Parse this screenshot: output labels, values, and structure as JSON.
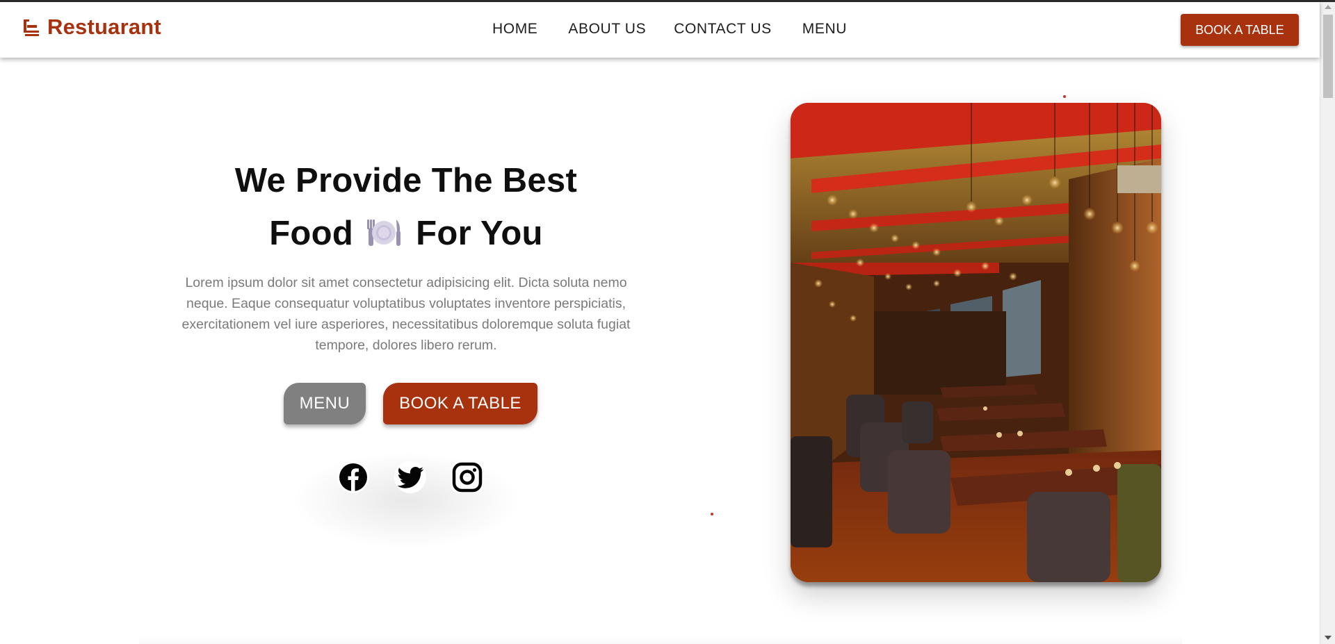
{
  "brand": {
    "name": "Restuarant",
    "icon": "chef-hat-icon",
    "color": "#a8320d"
  },
  "nav": {
    "items": [
      {
        "label": "HOME"
      },
      {
        "label": "ABOUT US"
      },
      {
        "label": "CONTACT US"
      },
      {
        "label": "MENU"
      }
    ],
    "cta_label": "BOOK A TABLE"
  },
  "hero": {
    "title_line1": "We Provide The Best",
    "title_word1": "Food",
    "title_emoji": "plate-fork-knife-icon",
    "title_word2": "For You",
    "description": "Lorem ipsum dolor sit amet consectetur adipisicing elit. Dicta soluta nemo neque. Eaque consequatur voluptatibus voluptates inventore perspiciatis, exercitationem vel iure asperiores, necessitatibus doloremque soluta fugiat tempore, dolores libero rerum.",
    "menu_button": "MENU",
    "book_button": "BOOK A TABLE",
    "social": [
      "facebook-icon",
      "twitter-icon",
      "instagram-icon"
    ]
  },
  "image": {
    "subject": "restaurant-interior-photo"
  },
  "colors": {
    "accent": "#a8320d",
    "gray_button": "#808080",
    "text_muted": "#7a7a7a"
  }
}
